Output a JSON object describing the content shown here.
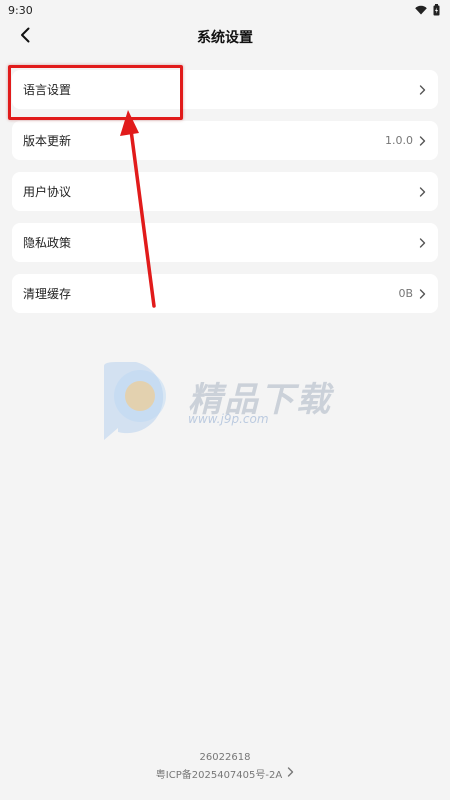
{
  "status_bar": {
    "time": "9:30",
    "icons": [
      "wifi-icon",
      "battery-icon"
    ]
  },
  "header": {
    "title": "系统设置",
    "back_icon": "chevron-left-icon"
  },
  "settings": [
    {
      "id": "language",
      "label": "语言设置",
      "value": ""
    },
    {
      "id": "version",
      "label": "版本更新",
      "value": "1.0.0"
    },
    {
      "id": "agreement",
      "label": "用户协议",
      "value": ""
    },
    {
      "id": "privacy",
      "label": "隐私政策",
      "value": ""
    },
    {
      "id": "cache",
      "label": "清理缓存",
      "value": "0B"
    }
  ],
  "watermark": {
    "name": "精品下载",
    "url": "www.j9p.com"
  },
  "footer": {
    "build": "26022618",
    "icp": "粤ICP备2025407405号-2A"
  },
  "colors": {
    "background": "#f4f4f4",
    "card": "#ffffff",
    "annotation": "#e11b1b"
  }
}
